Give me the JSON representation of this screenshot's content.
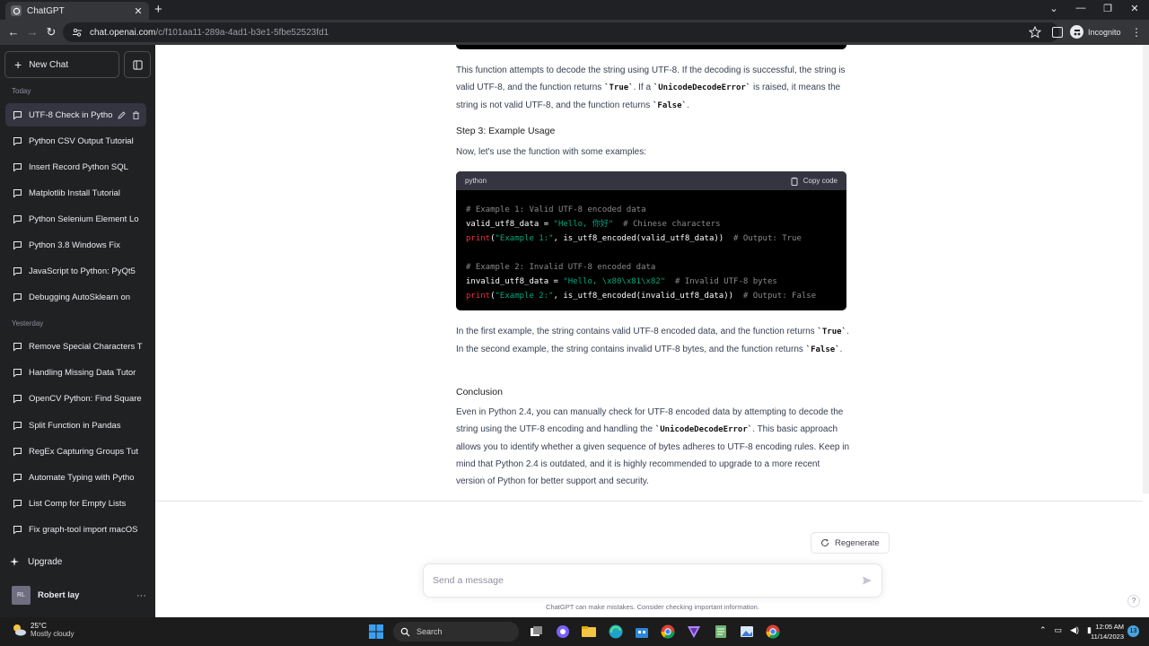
{
  "browser": {
    "tab_title": "ChatGPT",
    "url_host": "chat.openai.com",
    "url_path": "/c/f101aa11-289a-4ad1-b3e1-5fbe52523fd1",
    "incognito_label": "Incognito"
  },
  "sidebar": {
    "new_chat_label": "New Chat",
    "today_label": "Today",
    "yesterday_label": "Yesterday",
    "today_items": [
      {
        "label": "UTF-8 Check in Pytho"
      },
      {
        "label": "Python CSV Output Tutorial"
      },
      {
        "label": "Insert Record Python SQL"
      },
      {
        "label": "Matplotlib Install Tutorial"
      },
      {
        "label": "Python Selenium Element Lo"
      },
      {
        "label": "Python 3.8 Windows Fix"
      },
      {
        "label": "JavaScript to Python: PyQt5"
      },
      {
        "label": "Debugging AutoSklearn on"
      }
    ],
    "yesterday_items": [
      {
        "label": "Remove Special Characters T"
      },
      {
        "label": "Handling Missing Data Tutor"
      },
      {
        "label": "OpenCV Python: Find Square"
      },
      {
        "label": "Split Function in Pandas"
      },
      {
        "label": "RegEx Capturing Groups Tut"
      },
      {
        "label": "Automate Typing with Pytho"
      },
      {
        "label": "List Comp for Empty Lists"
      },
      {
        "label": "Fix graph-tool import macOS"
      }
    ],
    "upgrade_label": "Upgrade",
    "user_initials": "RL",
    "user_name": "Robert lay",
    "more_label": "···"
  },
  "content": {
    "para1_a": "This function attempts to decode the string using UTF-8. If the decoding is successful, the string is valid UTF-8, and the function returns ",
    "para1_code1": "`True`",
    "para1_b": ". If a ",
    "para1_code2": "`UnicodeDecodeError`",
    "para1_c": " is raised, it means the string is not valid UTF-8, and the function returns ",
    "para1_code3": "`False`",
    "para1_d": ".",
    "step3_heading": "Step 3: Example Usage",
    "step3_intro": "Now, let's use the function with some examples:",
    "code_lang": "python",
    "copy_label": "Copy code",
    "code": {
      "l1": "# Example 1: Valid UTF-8 encoded data",
      "l2_var": "valid_utf8_data = ",
      "l2_str": "\"Hello, 你好\"",
      "l2_cm": "  # Chinese characters",
      "l3_fn": "print",
      "l3_open": "(",
      "l3_str": "\"Example 1:\"",
      "l3_rest": ", is_utf8_encoded(valid_utf8_data))",
      "l3_cm": "  # Output: True",
      "l5": "# Example 2: Invalid UTF-8 encoded data",
      "l6_var": "invalid_utf8_data = ",
      "l6_str": "\"Hello, \\x80\\x81\\x82\"",
      "l6_cm": "  # Invalid UTF-8 bytes",
      "l7_fn": "print",
      "l7_open": "(",
      "l7_str": "\"Example 2:\"",
      "l7_rest": ", is_utf8_encoded(invalid_utf8_data))",
      "l7_cm": "  # Output: False"
    },
    "para2_a": "In the first example, the string contains valid UTF-8 encoded data, and the function returns ",
    "para2_code1": "`True`",
    "para2_b": ". In the second example, the string contains invalid UTF-8 bytes, and the function returns ",
    "para2_code2": "`False`",
    "para2_c": ".",
    "conclusion_heading": "Conclusion",
    "para3_a": "Even in Python 2.4, you can manually check for UTF-8 encoded data by attempting to decode the string using the UTF-8 encoding and handling the ",
    "para3_code": "`UnicodeDecodeError`",
    "para3_b": ". This basic approach allows you to identify whether a given sequence of bytes adheres to UTF-8 encoding rules. Keep in mind that Python 2.4 is outdated, and it is highly recommended to upgrade to a more recent version of Python for better support and security."
  },
  "composer": {
    "regenerate_label": "Regenerate",
    "placeholder": "Send a message",
    "disclaimer": "ChatGPT can make mistakes. Consider checking important information.",
    "help_label": "?"
  },
  "taskbar": {
    "weather_temp": "25°C",
    "weather_desc": "Mostly cloudy",
    "search_label": "Search",
    "time": "12:05 AM",
    "date": "11/14/2023",
    "notif_count": "13"
  }
}
